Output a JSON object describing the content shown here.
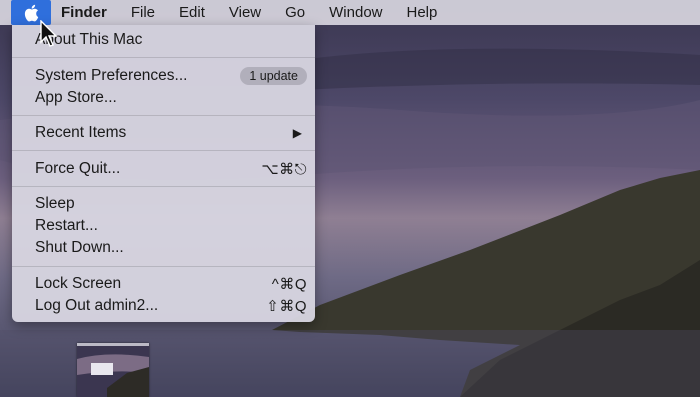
{
  "menubar": {
    "app_name": "Finder",
    "items": [
      "File",
      "Edit",
      "View",
      "Go",
      "Window",
      "Help"
    ]
  },
  "apple_menu": {
    "about": "About This Mac",
    "system_preferences": "System Preferences...",
    "update_badge": "1 update",
    "app_store": "App Store...",
    "recent_items": "Recent Items",
    "force_quit": "Force Quit...",
    "force_quit_shortcut": "⌥⌘⎋",
    "sleep": "Sleep",
    "restart": "Restart...",
    "shut_down": "Shut Down...",
    "lock_screen": "Lock Screen",
    "lock_screen_shortcut": "^⌘Q",
    "log_out": "Log Out admin2...",
    "log_out_shortcut": "⇧⌘Q"
  },
  "icons": {
    "apple": "apple-logo-icon",
    "submenu": "chevron-right-icon",
    "cursor": "mouse-pointer-icon"
  },
  "colors": {
    "menu_highlight": "#2f6fdc",
    "menu_background": "#d6d4e0"
  }
}
